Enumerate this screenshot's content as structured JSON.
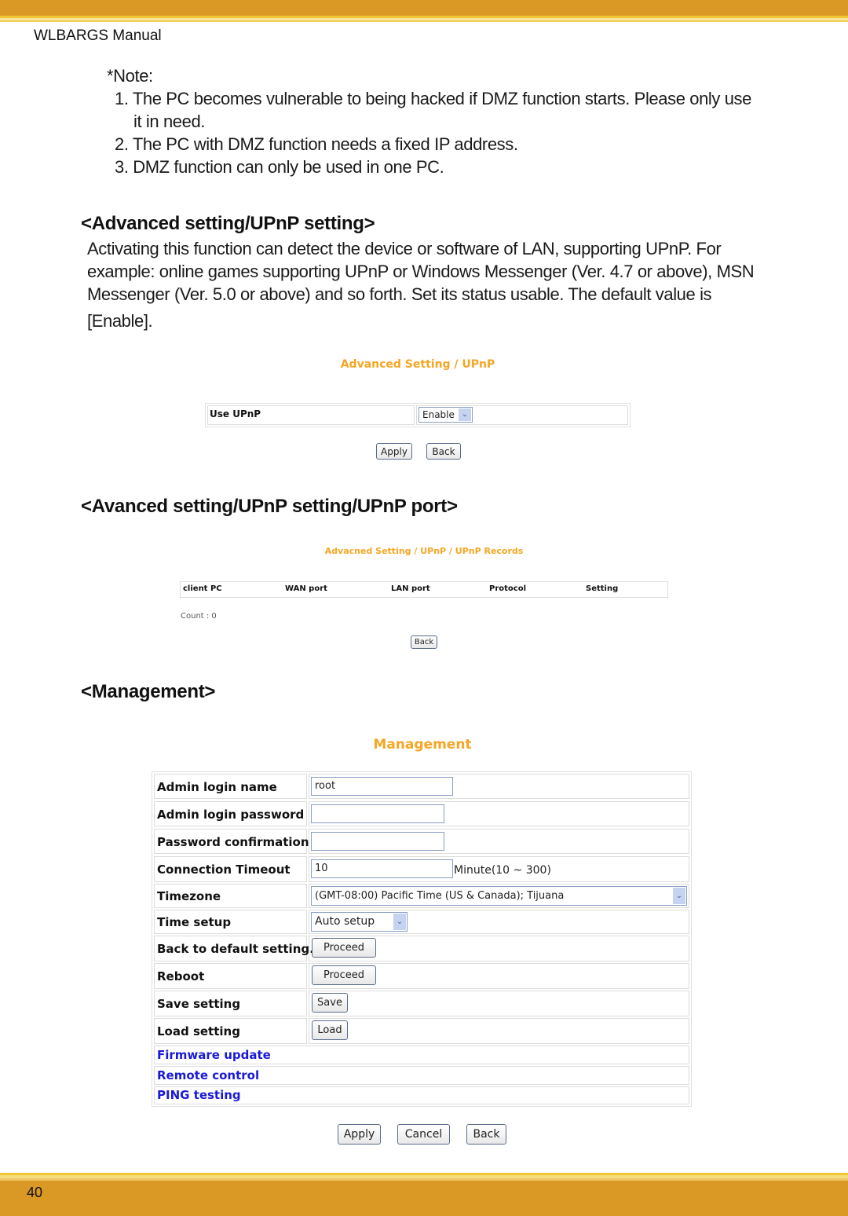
{
  "header": {
    "manual_title": "WLBARGS Manual"
  },
  "footer": {
    "page_number": "40"
  },
  "note": {
    "label": "*Note:",
    "items": [
      {
        "line1": "1. The PC becomes vulnerable to being hacked if DMZ function starts.  Please only use",
        "line2": "it in need."
      },
      {
        "line1": "2. The PC with DMZ function needs a fixed IP address."
      },
      {
        "line1": "3. DMZ function can only be used in one PC."
      }
    ]
  },
  "upnp_section": {
    "heading": "<Advanced setting/UPnP setting>",
    "paragraph_lines": [
      "Activating this function can detect the device or software of LAN, supporting UPnP.  For",
      "example: online games supporting UPnP or Windows Messenger (Ver. 4.7 or above), MSN",
      "Messenger (Ver. 5.0 or above) and so forth.  Set its status usable. The default value is",
      "[Enable]."
    ],
    "screen": {
      "title": "Advanced Setting / UPnP",
      "row_label": "Use UPnP",
      "select_value": "Enable",
      "apply_label": "Apply",
      "back_label": "Back"
    }
  },
  "upnp_port_section": {
    "heading": "<Avanced setting/UPnP setting/UPnP port>",
    "screen": {
      "title": "Advacned Setting / UPnP / UPnP Records",
      "columns": [
        "client PC",
        "WAN port",
        "LAN port",
        "Protocol",
        "Setting"
      ],
      "count_text": "Count : 0",
      "back_label": "Back"
    }
  },
  "management_section": {
    "heading": "<Management>",
    "screen": {
      "title": "Management",
      "rows": {
        "admin_login_name": {
          "label": "Admin login name",
          "value": "root"
        },
        "admin_login_password": {
          "label": "Admin login password",
          "value": ""
        },
        "password_confirmation": {
          "label": "Password confirmation",
          "value": ""
        },
        "connection_timeout": {
          "label": "Connection Timeout",
          "value": "10",
          "unit": "Minute(10 ~ 300)"
        },
        "timezone": {
          "label": "Timezone",
          "value": "(GMT-08:00) Pacific Time (US & Canada); Tijuana"
        },
        "time_setup": {
          "label": "Time setup",
          "value": "Auto setup"
        },
        "back_to_default": {
          "label": "Back to default setting.",
          "button": "Proceed"
        },
        "reboot": {
          "label": "Reboot",
          "button": "Proceed"
        },
        "save_setting": {
          "label": "Save setting",
          "button": "Save"
        },
        "load_setting": {
          "label": "Load setting",
          "button": "Load"
        }
      },
      "links": [
        "Firmware update",
        "Remote control",
        "PING testing"
      ],
      "apply_label": "Apply",
      "cancel_label": "Cancel",
      "back_label": "Back"
    }
  }
}
